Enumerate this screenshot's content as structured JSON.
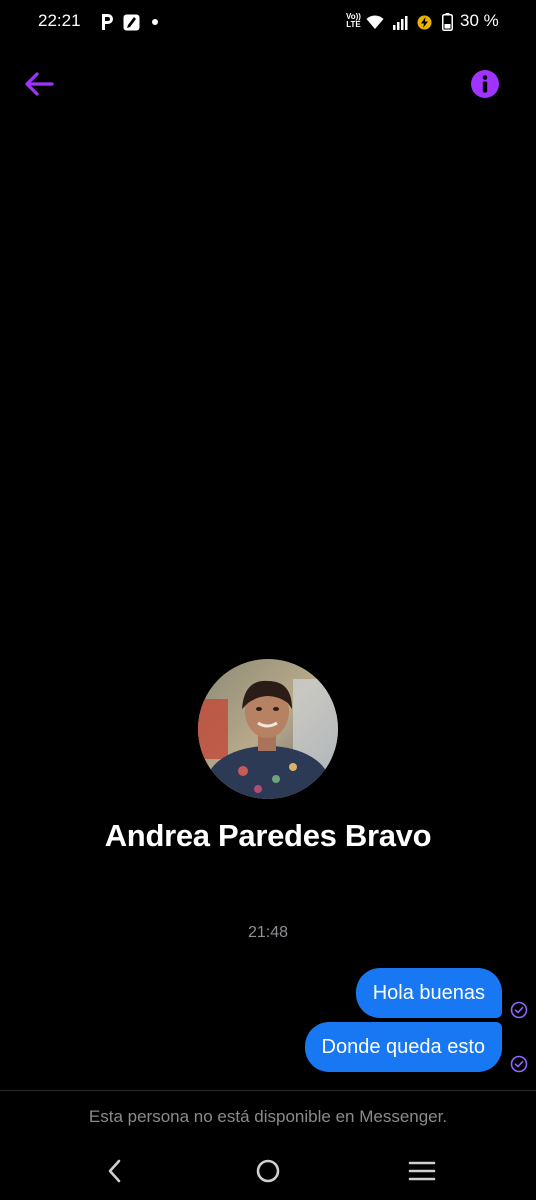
{
  "status_bar": {
    "time": "22:21",
    "volte_top": "Vo))",
    "volte_bottom": "LTE",
    "battery": "30 %"
  },
  "header": {
    "back_icon": "arrow-left-icon",
    "info_icon": "info-icon",
    "accent_color": "#a033ff"
  },
  "profile": {
    "name": "Andrea Paredes Bravo"
  },
  "conversation": {
    "timestamp": "21:48",
    "messages": [
      {
        "text": "Hola buenas",
        "sender": "me",
        "status_icon": "check-circle-icon"
      },
      {
        "text": "Donde queda esto",
        "sender": "me",
        "status_icon": "check-circle-icon"
      }
    ],
    "bubble_color": "#1877f2"
  },
  "footer": {
    "notice": "Esta persona no está disponible en Messenger."
  },
  "nav_bar": {
    "back_icon": "nav-back-icon",
    "home_icon": "nav-home-icon",
    "recents_icon": "nav-menu-icon"
  }
}
